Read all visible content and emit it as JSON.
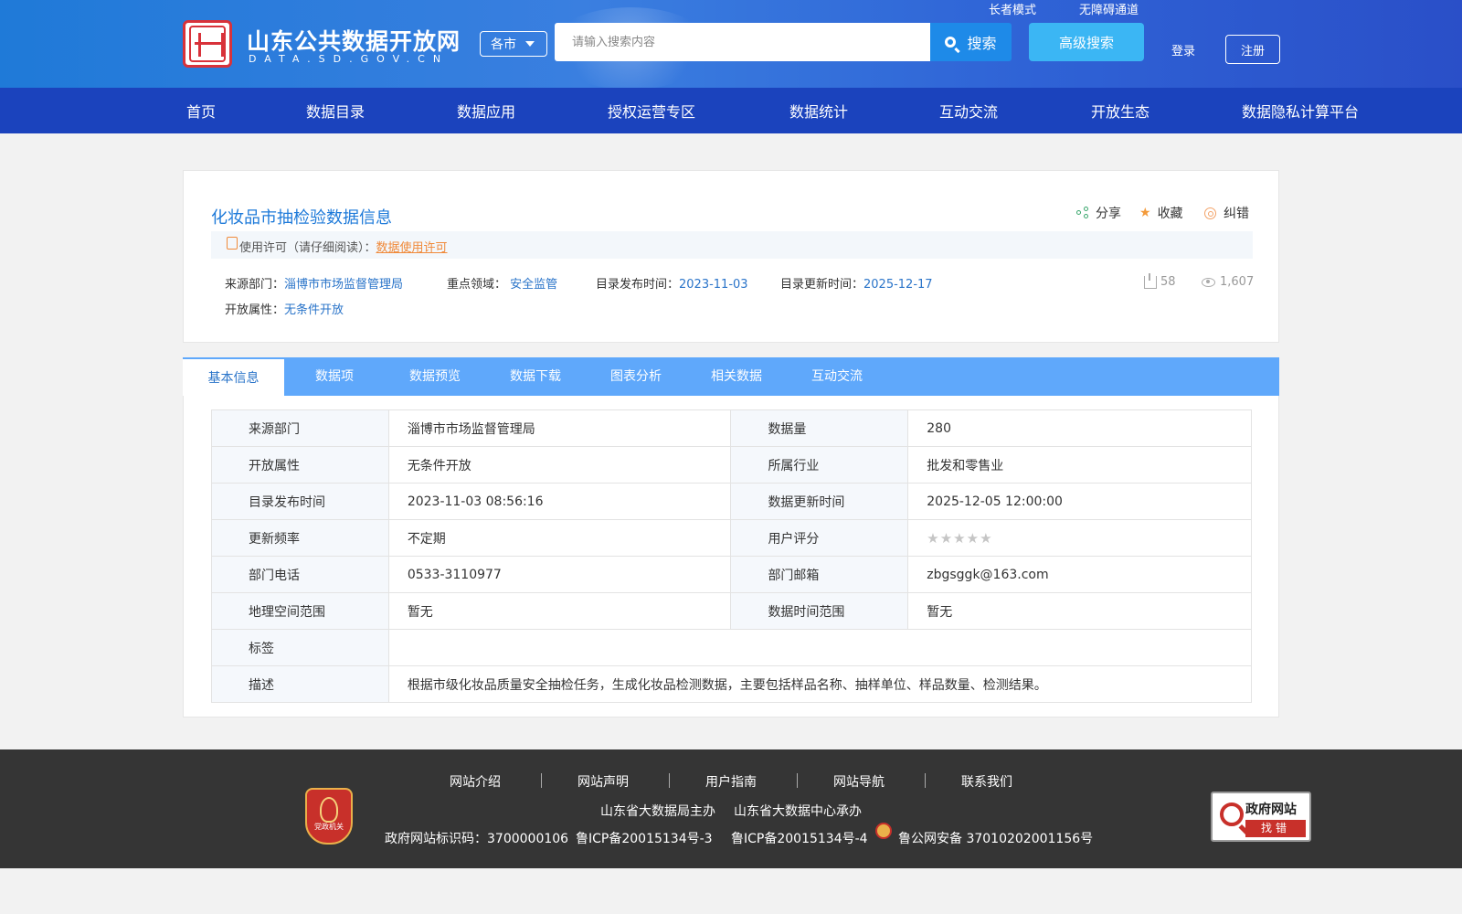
{
  "header": {
    "site_title": "山东公共数据开放网",
    "site_domain": "DATA.SD.GOV.CN",
    "city_select": "各市",
    "search_placeholder": "请输入搜索内容",
    "search_button": "搜索",
    "advanced_search": "高级搜索",
    "elder_mode": "长者模式",
    "accessible": "无障碍通道",
    "login": "登录",
    "register": "注册"
  },
  "nav": [
    "首页",
    "数据目录",
    "数据应用",
    "授权运营专区",
    "数据统计",
    "互动交流",
    "开放生态",
    "数据隐私计算平台"
  ],
  "dataset": {
    "title": "化妆品市抽检验数据信息",
    "actions": {
      "share": "分享",
      "favorite": "收藏",
      "correct": "纠错"
    },
    "license_prefix": "使用许可（请仔细阅读）：",
    "license_link": "数据使用许可",
    "source_label": "来源部门：",
    "source_value": "淄博市市场监督管理局",
    "domain_label": "重点领域：",
    "domain_value": "安全监管",
    "publish_label": "目录发布时间：",
    "publish_value": "2023-11-03",
    "update_label": "目录更新时间：",
    "update_value": "2025-12-17",
    "open_label": "开放属性：",
    "open_value": "无条件开放",
    "downloads": "58",
    "views": "1,607"
  },
  "tabs": [
    "基本信息",
    "数据项",
    "数据预览",
    "数据下载",
    "图表分析",
    "相关数据",
    "互动交流"
  ],
  "info": {
    "source_dept_label": "来源部门",
    "source_dept": "淄博市市场监督管理局",
    "data_count_label": "数据量",
    "data_count": "280",
    "open_attr_label": "开放属性",
    "open_attr": "无条件开放",
    "industry_label": "所属行业",
    "industry": "批发和零售业",
    "publish_time_label": "目录发布时间",
    "publish_time": "2023-11-03 08:56:16",
    "update_time_label": "数据更新时间",
    "update_time": "2025-12-05 12:00:00",
    "freq_label": "更新频率",
    "freq": "不定期",
    "rating_label": "用户评分",
    "rating": 0,
    "phone_label": "部门电话",
    "phone": "0533-3110977",
    "email_label": "部门邮箱",
    "email": "zbgsggk@163.com",
    "geo_label": "地理空间范围",
    "geo": "暂无",
    "time_range_label": "数据时间范围",
    "time_range": "暂无",
    "tags_label": "标签",
    "tags": "",
    "desc_label": "描述",
    "desc": "根据市级化妆品质量安全抽检任务，生成化妆品检测数据，主要包括样品名称、抽样单位、样品数量、检测结果。"
  },
  "footer": {
    "links": [
      "网站介绍",
      "网站声明",
      "用户指南",
      "网站导航",
      "联系我们"
    ],
    "host": "山东省大数据局主办",
    "organizer": "山东省大数据中心承办",
    "site_id": "政府网站标识码：3700000106",
    "icp3": "鲁ICP备20015134号-3",
    "icp4": "鲁ICP备20015134号-4",
    "police": "鲁公网安备 37010202001156号",
    "emblem_text": "党政机关",
    "gov_badge_top": "政府网站",
    "gov_badge_bottom": "找错"
  }
}
